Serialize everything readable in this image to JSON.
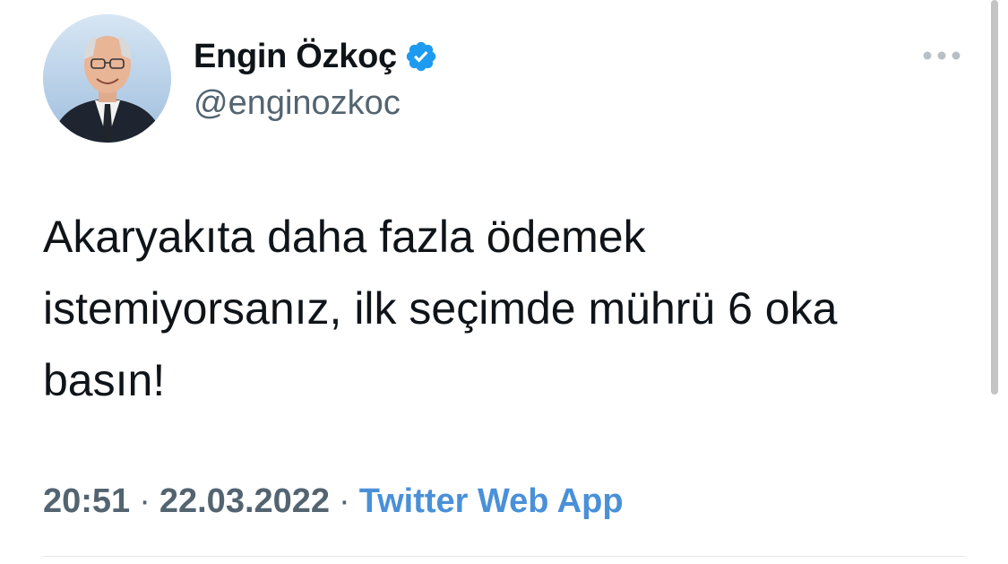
{
  "tweet": {
    "author": {
      "display_name": "Engin Özkoç",
      "handle": "@enginozkoc",
      "verified": true,
      "avatar_icon": "profile-photo"
    },
    "text": "Akaryakıta daha fazla ödemek istemiyorsanız, ilk seçimde mührü 6 oka basın!",
    "time": "20:51",
    "date": "22.03.2022",
    "separator": "·",
    "source": "Twitter Web App",
    "more_icon": "more-options-icon"
  },
  "colors": {
    "text_primary": "#0f1419",
    "text_secondary": "#536471",
    "verified_blue": "#1d9bf0",
    "source_link": "#4a90d9"
  }
}
